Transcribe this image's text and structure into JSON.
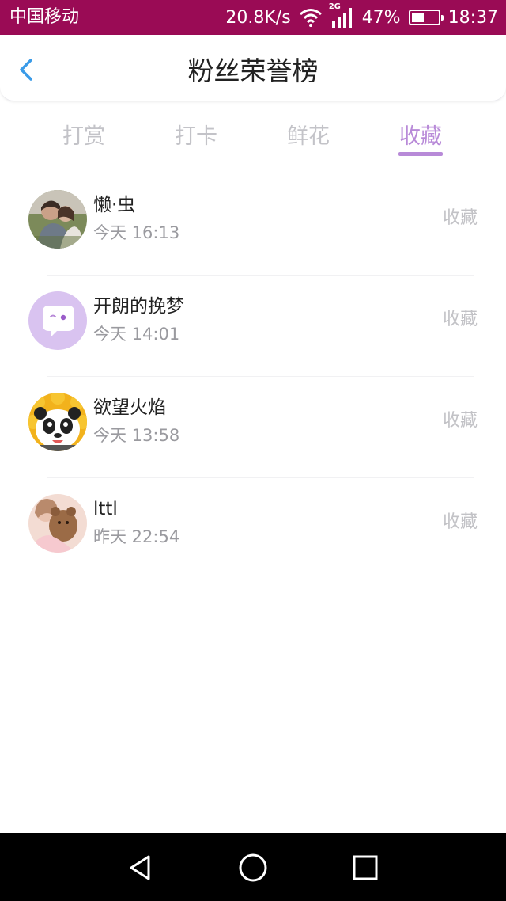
{
  "status_bar": {
    "carrier": "中国移动",
    "net_speed": "20.8K/s",
    "network_type": "2G",
    "battery_percent": "47%",
    "battery_level": 0.47,
    "time": "18:37",
    "background_color": "#9a0b55"
  },
  "header": {
    "title": "粉丝荣誉榜",
    "back_icon": "chevron-left-icon",
    "back_icon_color": "#3a9be8"
  },
  "tabs": [
    {
      "label": "打赏",
      "active": false
    },
    {
      "label": "打卡",
      "active": false
    },
    {
      "label": "鲜花",
      "active": false
    },
    {
      "label": "收藏",
      "active": true
    }
  ],
  "accent_color": "#b88ad8",
  "list": [
    {
      "name": "懒·虫",
      "time": "今天 16:13",
      "type": "收藏",
      "avatar": "photo-couple"
    },
    {
      "name": "开朗的挽梦",
      "time": "今天 14:01",
      "type": "收藏",
      "avatar": "default-chat-bubble"
    },
    {
      "name": "欲望火焰",
      "time": "今天 13:58",
      "type": "收藏",
      "avatar": "panda-sun"
    },
    {
      "name": "lttl",
      "time": "昨天 22:54",
      "type": "收藏",
      "avatar": "photo-girl-bear"
    }
  ],
  "navbar": {
    "back_icon": "triangle-back-icon",
    "home_icon": "circle-home-icon",
    "recents_icon": "square-recents-icon"
  }
}
